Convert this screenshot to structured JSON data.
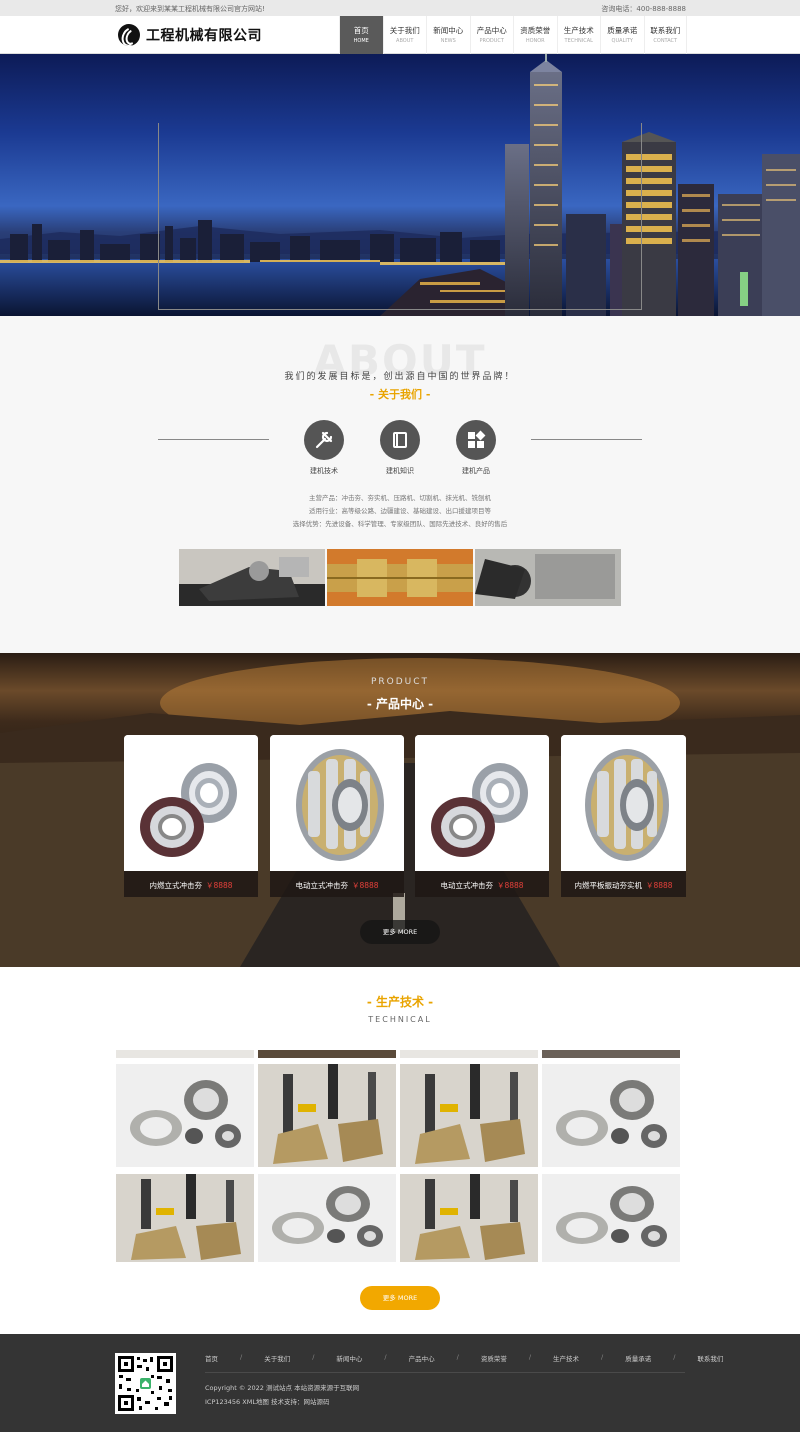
{
  "topbar": {
    "welcome": "您好，欢迎来到某某工程机械有限公司官方网站!",
    "phone_label": "咨询电话：",
    "phone": "400-888-8888"
  },
  "header": {
    "company": "工程机械有限公司",
    "nav": [
      {
        "cn": "首页",
        "en": "HOME"
      },
      {
        "cn": "关于我们",
        "en": "ABOUT"
      },
      {
        "cn": "新闻中心",
        "en": "NEWS"
      },
      {
        "cn": "产品中心",
        "en": "PRODUCT"
      },
      {
        "cn": "资质荣誉",
        "en": "HONOR"
      },
      {
        "cn": "生产技术",
        "en": "TECHNICAL"
      },
      {
        "cn": "质量承诺",
        "en": "QUALITY"
      },
      {
        "cn": "联系我们",
        "en": "CONTACT"
      }
    ]
  },
  "about": {
    "bigword": "ABOUT",
    "slogan": "我们的发展目标是，创出源自中国的世界品牌！",
    "title": "- 关于我们 -",
    "features": [
      {
        "label": "建机技术",
        "icon": "tools-icon"
      },
      {
        "label": "建机知识",
        "icon": "book-icon"
      },
      {
        "label": "建机产品",
        "icon": "grid-icon"
      }
    ],
    "lines": [
      "主营产品：冲击夯、夯实机、压路机、切割机、抹光机、铣刨机",
      "适用行业：高等级公路、边疆建设、基础建设、出口援建项目等",
      "选择优势：先进设备、科学管理、专家级团队、国际先进技术、良好的售后"
    ]
  },
  "product": {
    "en": "PRODUCT",
    "cn": "- 产品中心 -",
    "items": [
      {
        "name": "内燃立式冲击夯",
        "price": "￥8888",
        "image": "ball-bearing"
      },
      {
        "name": "电动立式冲击夯",
        "price": "￥8888",
        "image": "roller-bearing"
      },
      {
        "name": "电动立式冲击夯",
        "price": "￥8888",
        "image": "ball-bearing"
      },
      {
        "name": "内燃平板振动夯实机",
        "price": "￥8888",
        "image": "roller-bearing"
      }
    ],
    "more": "更多 MORE"
  },
  "technical": {
    "cn": "- 生产技术 -",
    "en": "TECHNICAL",
    "more": "更多 MORE"
  },
  "footer": {
    "links": [
      "首页",
      "关于我们",
      "新闻中心",
      "产品中心",
      "资质荣誉",
      "生产技术",
      "质量承诺",
      "联系我们"
    ],
    "separator": "/",
    "copyright": "Copyright © 2022 测试站点 本站资源来源于互联网",
    "icp": "ICP123456 XML地图 技术支持：网站源码"
  },
  "colors": {
    "accent": "#e9a400",
    "button_gold": "#f2a800",
    "price_red": "#e3403a",
    "footer_bg": "#343434",
    "nav_active": "#5a5a5a"
  }
}
